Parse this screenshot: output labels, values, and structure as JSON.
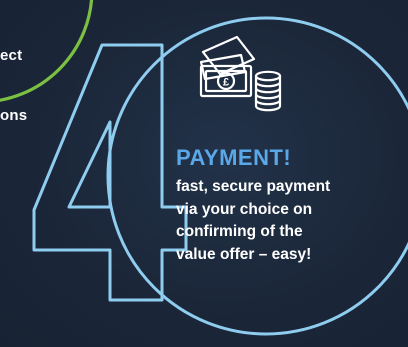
{
  "previous_step": {
    "lines": [
      "ect",
      "ons"
    ]
  },
  "step": {
    "number": "4",
    "heading": "PAYMENT!",
    "description_lines": [
      "fast, secure payment",
      "via your choice on",
      "confirming of the",
      "value offer – easy!"
    ]
  },
  "colors": {
    "background": "#1b2739",
    "circle_outline": "#8fcdf0",
    "previous_circle_outline": "#7cc043",
    "heading": "#5aa8e8",
    "text": "#ffffff"
  },
  "icons": {
    "step_icon": "banknotes-and-coins-icon",
    "currency_symbol": "£"
  }
}
